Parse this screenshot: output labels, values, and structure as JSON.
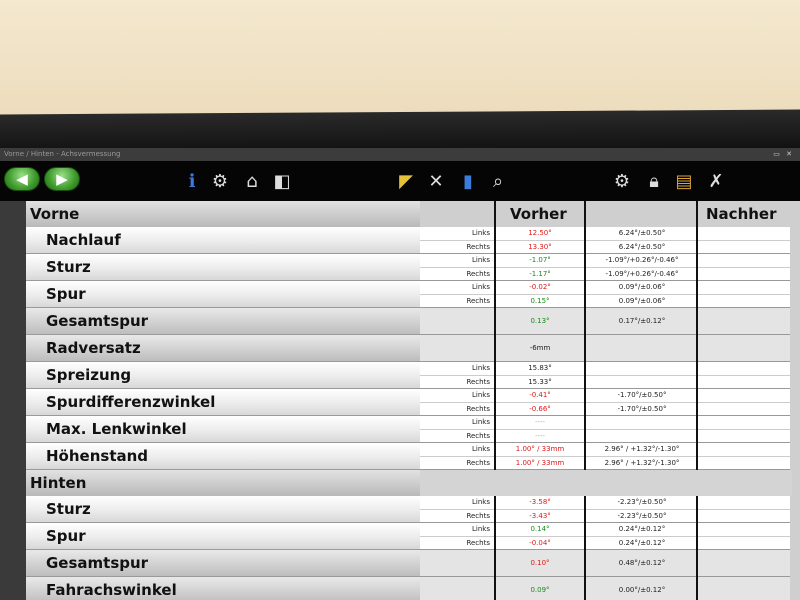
{
  "titlebar": {
    "text": "Vorne / Hinten - Achsvermessung",
    "controls": "▭ ✕"
  },
  "toolbar": {
    "back_icon": "arrow-left-icon",
    "forward_icon": "arrow-right-icon"
  },
  "headers": {
    "vorher": "Vorher",
    "nachher": "Nachher"
  },
  "sections": [
    {
      "title": "Vorne",
      "params": [
        {
          "label": "Nachlauf",
          "rows": [
            {
              "side": "Links",
              "value": "12.50°",
              "color": "red",
              "tol": "6.24°/±0.50°"
            },
            {
              "side": "Rechts",
              "value": "13.30°",
              "color": "red",
              "tol": "6.24°/±0.50°"
            }
          ]
        },
        {
          "label": "Sturz",
          "rows": [
            {
              "side": "Links",
              "value": "-1.07°",
              "color": "green",
              "tol": "-1.09°/+0.26°/-0.46°"
            },
            {
              "side": "Rechts",
              "value": "-1.17°",
              "color": "green",
              "tol": "-1.09°/+0.26°/-0.46°"
            }
          ]
        },
        {
          "label": "Spur",
          "rows": [
            {
              "side": "Links",
              "value": "-0.02°",
              "color": "red",
              "tol": "0.09°/±0.06°"
            },
            {
              "side": "Rechts",
              "value": "0.15°",
              "color": "green",
              "tol": "0.09°/±0.06°"
            }
          ]
        },
        {
          "label": "Gesamtspur",
          "single": true,
          "rows": [
            {
              "side": "",
              "value": "0.13°",
              "color": "green",
              "tol": "0.17°/±0.12°"
            }
          ]
        },
        {
          "label": "Radversatz",
          "single": true,
          "rows": [
            {
              "side": "",
              "value": "-6mm",
              "color": "black",
              "tol": ""
            }
          ]
        },
        {
          "label": "Spreizung",
          "rows": [
            {
              "side": "Links",
              "value": "15.83°",
              "color": "black",
              "tol": ""
            },
            {
              "side": "Rechts",
              "value": "15.33°",
              "color": "black",
              "tol": ""
            }
          ]
        },
        {
          "label": "Spurdifferenzwinkel",
          "rows": [
            {
              "side": "Links",
              "value": "-0.41°",
              "color": "red",
              "tol": "-1.70°/±0.50°"
            },
            {
              "side": "Rechts",
              "value": "-0.66°",
              "color": "red",
              "tol": "-1.70°/±0.50°"
            }
          ]
        },
        {
          "label": "Max. Lenkwinkel",
          "rows": [
            {
              "side": "Links",
              "value": "----",
              "color": "grey",
              "tol": ""
            },
            {
              "side": "Rechts",
              "value": "----",
              "color": "grey",
              "tol": ""
            }
          ]
        },
        {
          "label": "Höhenstand",
          "rows": [
            {
              "side": "Links",
              "value": "1.00° / 33mm",
              "color": "red",
              "tol": "2.96° / +1.32°/-1.30°"
            },
            {
              "side": "Rechts",
              "value": "1.00° / 33mm",
              "color": "red",
              "tol": "2.96° / +1.32°/-1.30°"
            }
          ]
        }
      ]
    },
    {
      "title": "Hinten",
      "params": [
        {
          "label": "Sturz",
          "rows": [
            {
              "side": "Links",
              "value": "-3.58°",
              "color": "red",
              "tol": "-2.23°/±0.50°"
            },
            {
              "side": "Rechts",
              "value": "-3.43°",
              "color": "red",
              "tol": "-2.23°/±0.50°"
            }
          ]
        },
        {
          "label": "Spur",
          "rows": [
            {
              "side": "Links",
              "value": "0.14°",
              "color": "green",
              "tol": "0.24°/±0.12°"
            },
            {
              "side": "Rechts",
              "value": "-0.04°",
              "color": "red",
              "tol": "0.24°/±0.12°"
            }
          ]
        },
        {
          "label": "Gesamtspur",
          "single": true,
          "rows": [
            {
              "side": "",
              "value": "0.10°",
              "color": "red",
              "tol": "0.48°/±0.12°"
            }
          ]
        },
        {
          "label": "Fahrachswinkel",
          "single": true,
          "rows": [
            {
              "side": "",
              "value": "0.09°",
              "color": "green",
              "tol": "0.00°/±0.12°"
            }
          ]
        }
      ]
    }
  ]
}
